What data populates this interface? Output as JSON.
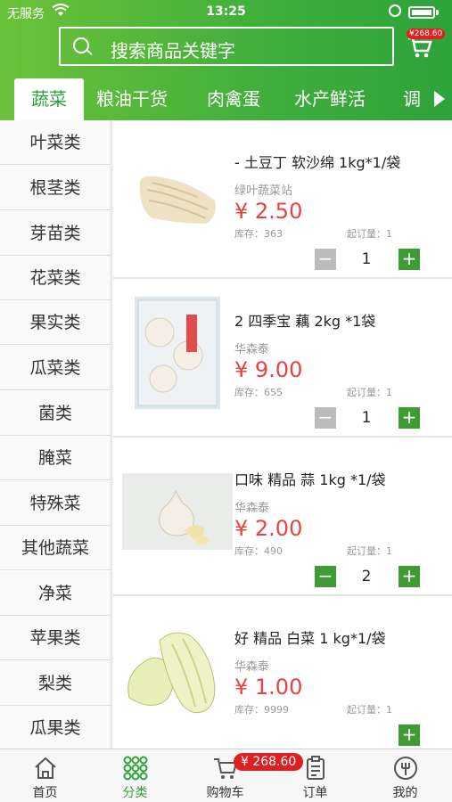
{
  "status_bar": {
    "carrier": "无服务",
    "time": "13:25"
  },
  "search": {
    "placeholder": "搜索商品关键字"
  },
  "cart_top": {
    "badge": "¥268.60"
  },
  "tabs": [
    "蔬菜",
    "粮油干货",
    "肉禽蛋",
    "水产鲜活",
    "调"
  ],
  "categories": [
    "叶菜类",
    "根茎类",
    "芽苗类",
    "花菜类",
    "果实类",
    "瓜菜类",
    "菌类",
    "腌菜",
    "特殊菜",
    "其他蔬菜",
    "净菜",
    "苹果类",
    "梨类",
    "瓜果类"
  ],
  "products": [
    {
      "name": "- 土豆丁 软沙绵 1kg*1/袋",
      "shop": "绿叶蔬菜站",
      "price": "¥ 2.50",
      "stock": "库存：363",
      "min_order": "起订量：1",
      "qty": "1",
      "minus_enabled": false
    },
    {
      "name": "2 四季宝 藕 2kg *1袋",
      "shop": "华森泰",
      "price": "¥ 9.00",
      "stock": "库存：655",
      "min_order": "起订量：1",
      "qty": "1",
      "minus_enabled": false
    },
    {
      "name": "口味 精品 蒜 1kg *1/袋",
      "shop": "华森泰",
      "price": "¥ 2.00",
      "stock": "库存：490",
      "min_order": "起订量：1",
      "qty": "2",
      "minus_enabled": true
    },
    {
      "name": "好 精品 白菜 1 kg*1/袋",
      "shop": "华森泰",
      "price": "¥ 1.00",
      "stock": "库存：9999",
      "min_order": "起订量：1",
      "qty": "",
      "minus_enabled": false
    }
  ],
  "bottom_nav": {
    "items": [
      "首页",
      "分类",
      "购物车",
      "订单",
      "我的"
    ],
    "cart_badge": "¥ 268.60"
  },
  "colors": {
    "brand_green": "#3fae3c",
    "price_red": "#e84242"
  },
  "icons": [
    "search-icon",
    "cart-icon",
    "home-icon",
    "category-icon",
    "order-icon",
    "user-icon"
  ]
}
